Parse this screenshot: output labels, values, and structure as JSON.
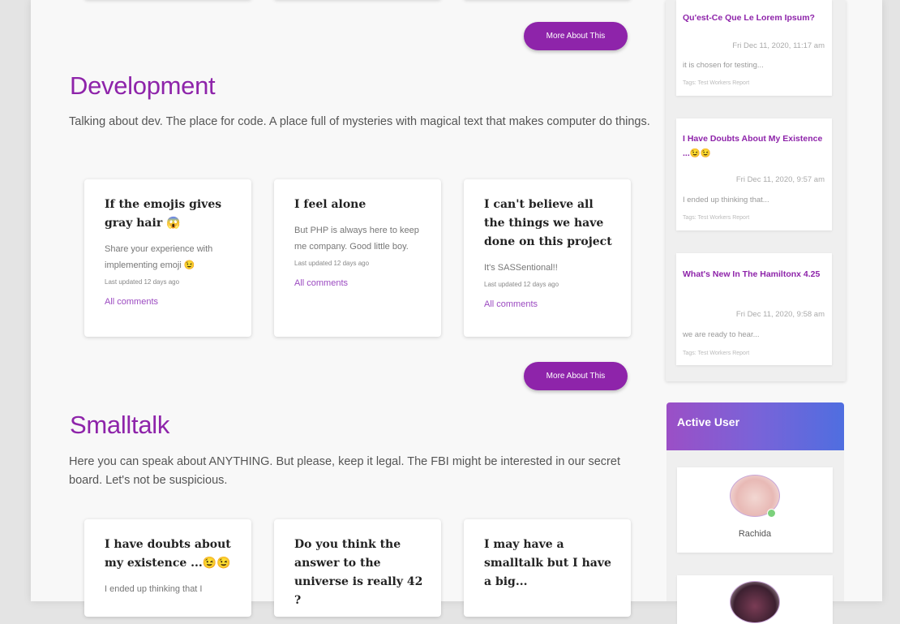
{
  "main": {
    "more_label": "More About This",
    "sections": [
      {
        "title": "Development",
        "description": "Talking about dev. The place for code. A place full of mysteries with magical text that makes computer do things.",
        "cards": [
          {
            "title": "If the emojis gives gray hair 😱",
            "text": "Share your experience with implementing emoji 😉",
            "updated": "Last updated 12 days ago",
            "link": "All comments"
          },
          {
            "title": "I feel alone",
            "text": "But PHP is always here to keep me company. Good little boy.",
            "updated": "Last updated 12 days ago",
            "link": "All comments"
          },
          {
            "title": "I can't believe all the things we have done on this project",
            "text": "It's SASSentional!!",
            "updated": "Last updated 12 days ago",
            "link": "All comments"
          }
        ]
      },
      {
        "title": "Smalltalk",
        "description": "Here you can speak about ANYTHING. But please, keep it legal. The FBI might be interested in our secret board. Let's not be suspicious.",
        "cards": [
          {
            "title": "I have doubts about my existence ...😉😉",
            "text": "I ended up thinking that I"
          },
          {
            "title": "Do you think the answer to the universe is really 42 ?"
          },
          {
            "title": "I may have a smalltalk but I have a big..."
          }
        ]
      }
    ]
  },
  "sidebar": {
    "posts": [
      {
        "title": "Qu'est-Ce Que Le Lorem Ipsum?",
        "date": "Fri Dec 11, 2020, 11:17 am",
        "excerpt": "it is chosen for testing...",
        "tags": "Tags: Test Workers Report"
      },
      {
        "title": "I Have Doubts About My Existence ...😉😉",
        "date": "Fri Dec 11, 2020, 9:57 am",
        "excerpt": "I ended up thinking that...",
        "tags": "Tags: Test Workers Report"
      },
      {
        "title": "What's New In The Hamiltonx 4.25",
        "date": "Fri Dec 11, 2020, 9:58 am",
        "excerpt": "we are ready to hear...",
        "tags": "Tags: Test Workers Report"
      }
    ]
  },
  "active_user": {
    "title": "Active User",
    "users": [
      {
        "name": "Rachida",
        "online": true
      },
      {
        "name": "",
        "online": false
      }
    ]
  }
}
